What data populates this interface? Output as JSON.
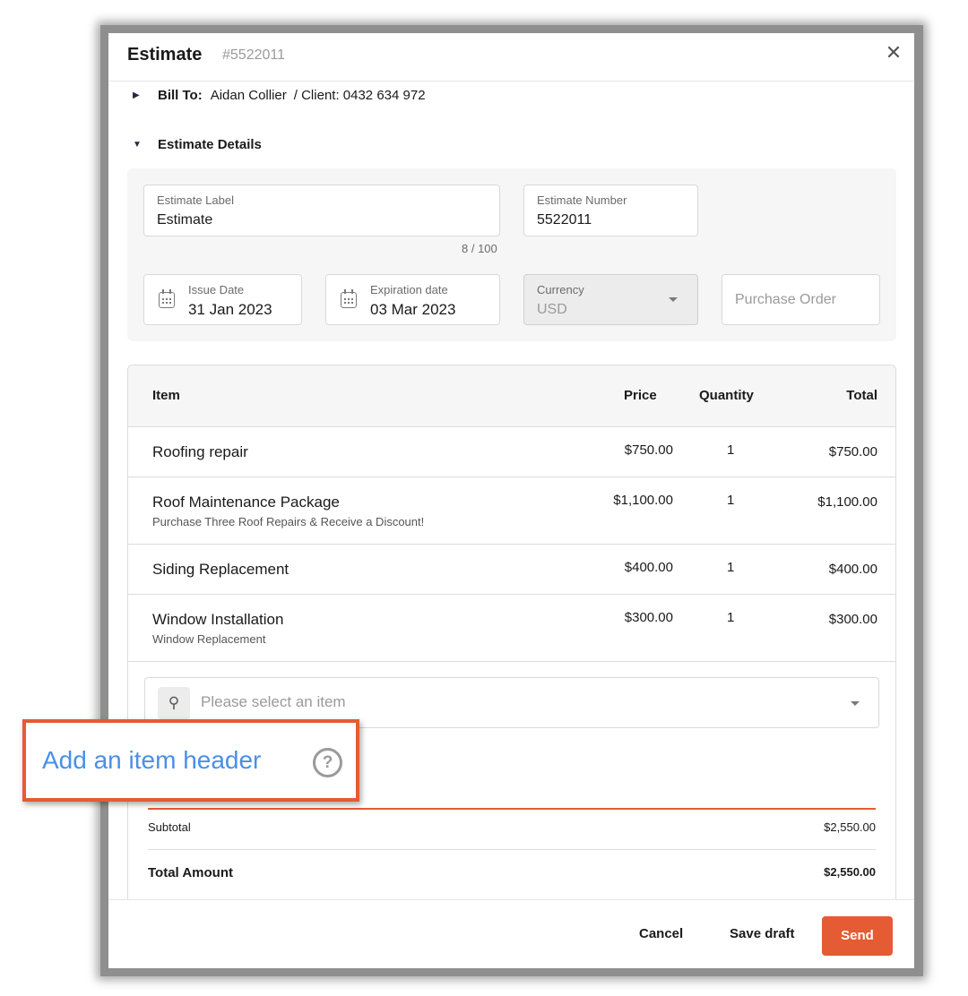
{
  "header": {
    "title": "Estimate",
    "number": "#5522011"
  },
  "bill_to": {
    "label": "Bill To:",
    "name": "Aidan Collier",
    "client": "/ Client: 0432 634 972"
  },
  "details": {
    "section_label": "Estimate Details",
    "estimate_label": {
      "label": "Estimate Label",
      "value": "Estimate",
      "counter": "8 / 100"
    },
    "estimate_number": {
      "label": "Estimate Number",
      "value": "5522011"
    },
    "issue_date": {
      "label": "Issue Date",
      "value": "31 Jan 2023"
    },
    "expiration_date": {
      "label": "Expiration date",
      "value": "03 Mar 2023"
    },
    "currency": {
      "label": "Currency",
      "value": "USD"
    },
    "purchase_order": {
      "placeholder": "Purchase Order"
    }
  },
  "table": {
    "columns": {
      "item": "Item",
      "price": "Price",
      "quantity": "Quantity",
      "total": "Total"
    },
    "rows": [
      {
        "name": "Roofing repair",
        "desc": "",
        "price": "$750.00",
        "qty": "1",
        "total": "$750.00"
      },
      {
        "name": "Roof Maintenance Package",
        "desc": "Purchase Three Roof Repairs & Receive a Discount!",
        "price": "$1,100.00",
        "qty": "1",
        "total": "$1,100.00"
      },
      {
        "name": "Siding Replacement",
        "desc": "",
        "price": "$400.00",
        "qty": "1",
        "total": "$400.00"
      },
      {
        "name": "Window Installation",
        "desc": "Window Replacement",
        "price": "$300.00",
        "qty": "1",
        "total": "$300.00"
      }
    ],
    "select_placeholder": "Please select an item",
    "subtotal_label": "Subtotal",
    "subtotal_value": "$2,550.00",
    "total_label": "Total Amount",
    "total_value": "$2,550.00"
  },
  "callout": {
    "link": "Add an item header",
    "help": "?"
  },
  "footer": {
    "cancel": "Cancel",
    "save_draft": "Save draft",
    "send": "Send"
  },
  "colors": {
    "accent": "#e55b33",
    "link": "#4a8fe7"
  }
}
